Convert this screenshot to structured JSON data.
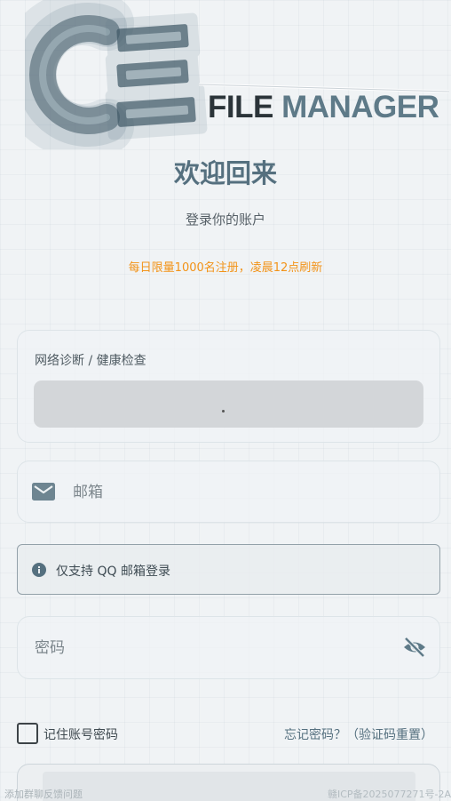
{
  "logo": {
    "word1": "FILE",
    "word2": "MANAGER"
  },
  "welcome_title": "欢迎回来",
  "subtitle": "登录你的账户",
  "notice": "每日限量1000名注册，凌晨12点刷新",
  "diagnostics": {
    "label": "网络诊断 / 健康检查"
  },
  "email": {
    "placeholder": "邮箱",
    "value": "",
    "icon": "mail-icon"
  },
  "info": {
    "text": "仅支持 QQ 邮箱登录",
    "icon": "info-icon"
  },
  "password": {
    "placeholder": "密码",
    "value": "",
    "icon": "eye-off-icon"
  },
  "remember": {
    "label": "记住账号密码",
    "checked": false
  },
  "forgot_link": "忘记密码？（验证码重置）",
  "footer": {
    "left": "添加群聊反馈问题",
    "right": "赣ICP备2025077271号-2A"
  },
  "colors": {
    "accent": "#55707f",
    "notice": "#f29318",
    "background": "#f0f3f5"
  }
}
